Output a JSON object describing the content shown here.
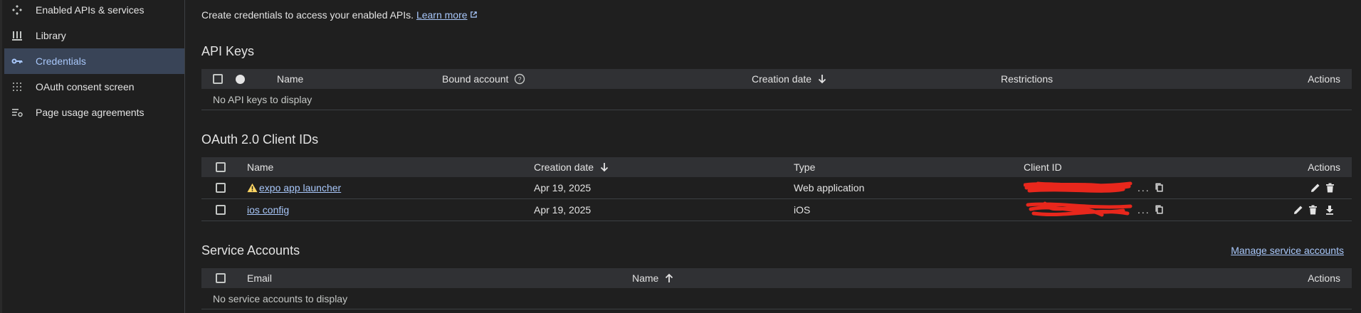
{
  "sidebar": {
    "items": [
      {
        "label": "Enabled APIs & services",
        "icon": "api-diamond-icon",
        "active": false
      },
      {
        "label": "Library",
        "icon": "library-icon",
        "active": false
      },
      {
        "label": "Credentials",
        "icon": "key-icon",
        "active": true
      },
      {
        "label": "OAuth consent screen",
        "icon": "oauth-dots-icon",
        "active": false
      },
      {
        "label": "Page usage agreements",
        "icon": "settings-list-icon",
        "active": false
      }
    ]
  },
  "intro": {
    "text": "Create credentials to access your enabled APIs.",
    "link": "Learn more"
  },
  "api_keys": {
    "title": "API Keys",
    "columns": {
      "name": "Name",
      "bound": "Bound account",
      "created": "Creation date",
      "restrictions": "Restrictions",
      "actions": "Actions"
    },
    "empty": "No API keys to display"
  },
  "oauth": {
    "title": "OAuth 2.0 Client IDs",
    "columns": {
      "name": "Name",
      "created": "Creation date",
      "type": "Type",
      "client_id": "Client ID",
      "actions": "Actions"
    },
    "rows": [
      {
        "name": "expo app launcher",
        "created": "Apr 19, 2025",
        "type": "Web application",
        "warning": true,
        "client_id_suffix": "..."
      },
      {
        "name": "ios config",
        "created": "Apr 19, 2025",
        "type": "iOS",
        "warning": false,
        "client_id_suffix": "..."
      }
    ]
  },
  "service_accounts": {
    "title": "Service Accounts",
    "manage_link": "Manage service accounts",
    "columns": {
      "email": "Email",
      "name": "Name",
      "actions": "Actions"
    },
    "empty": "No service accounts to display"
  },
  "colors": {
    "accent": "#a8c7fa",
    "active_bg": "#394457",
    "header_bg": "#303134",
    "redaction": "#e8271c"
  }
}
